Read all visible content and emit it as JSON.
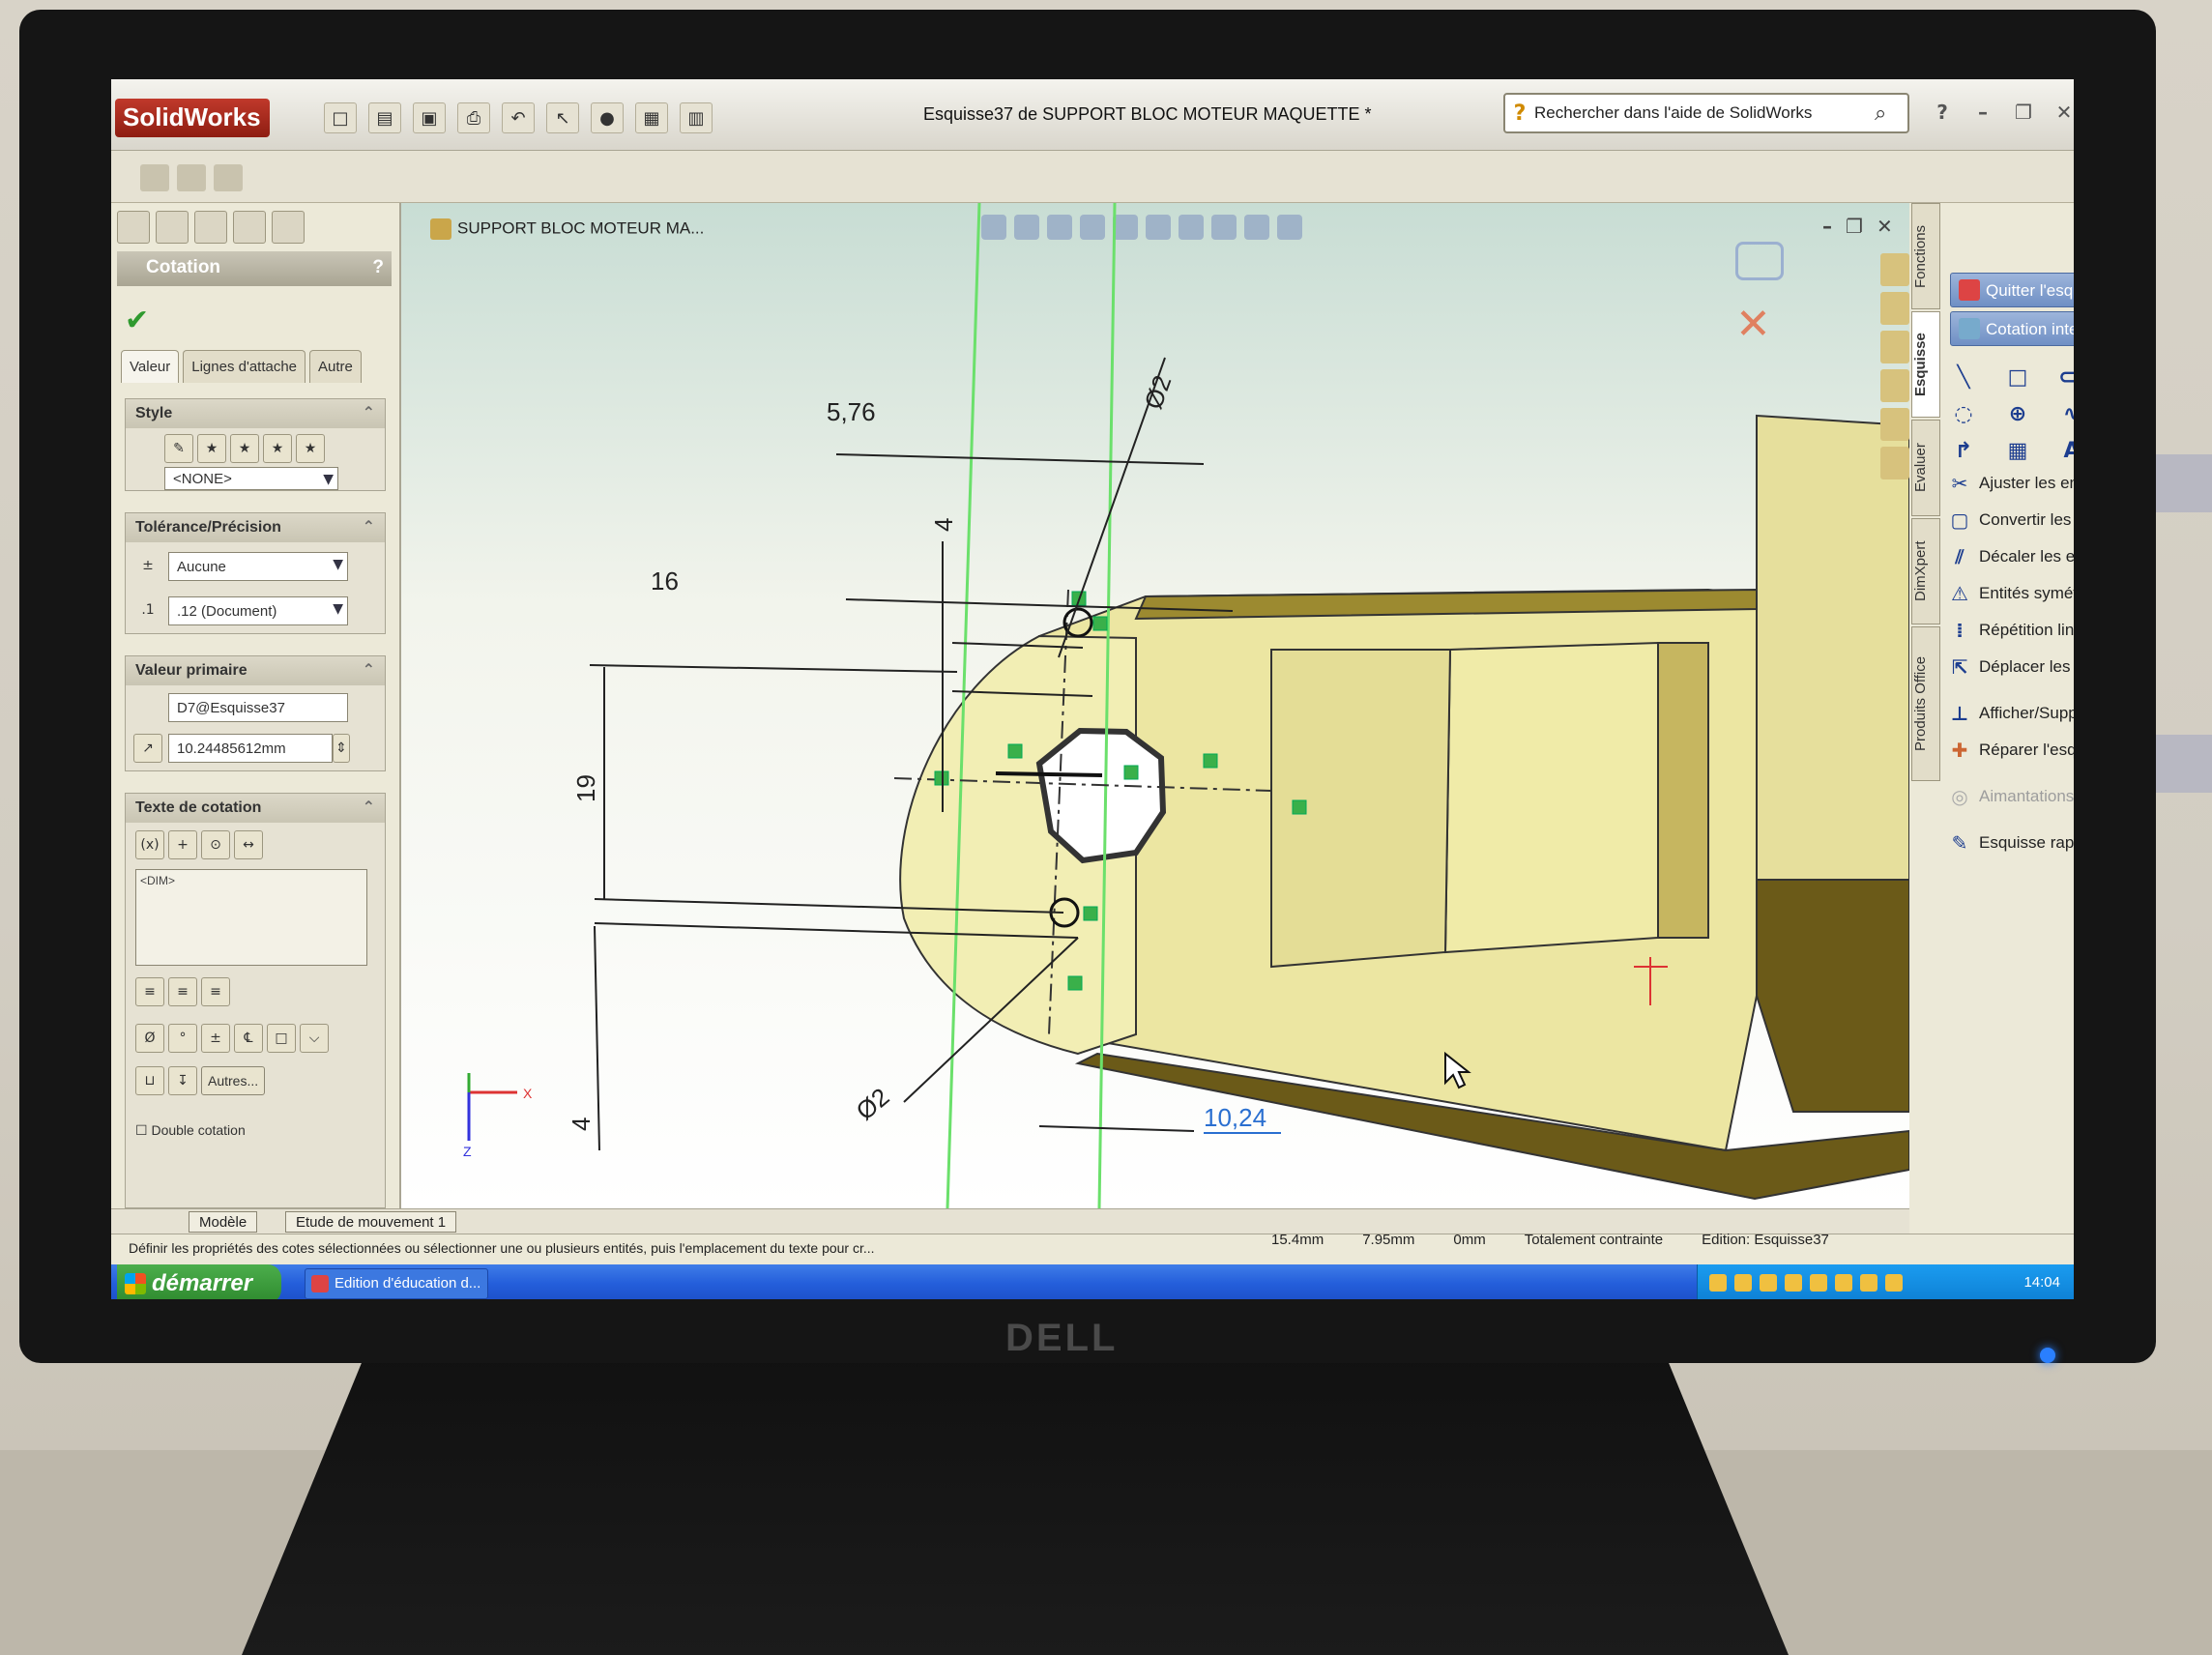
{
  "app": {
    "logo_text": "SolidWorks",
    "document_title": "Esquisse37 de SUPPORT BLOC MOTEUR MAQUETTE *",
    "help_search_text": "Rechercher dans l'aide de SolidWorks",
    "monitor_brand": "DELL"
  },
  "property_manager": {
    "title": "Cotation",
    "help": "?",
    "ok_icon": "check-icon",
    "tabs": [
      "Valeur",
      "Lignes d'attache",
      "Autre"
    ],
    "style": {
      "header": "Style",
      "favorite_value": "<NONE>"
    },
    "tolerance": {
      "header": "Tolérance/Précision",
      "tolerance_type": "Aucune",
      "precision": ".12 (Document)"
    },
    "primary_value": {
      "header": "Valeur primaire",
      "name": "D7@Esquisse37",
      "value": "10.24485612mm"
    },
    "dimension_text": {
      "header": "Texte de cotation",
      "text": "<DIM>",
      "more_button": "Autres...",
      "dual_dimension_label": "Double cotation"
    }
  },
  "graphics": {
    "breadcrumb": "SUPPORT BLOC MOTEUR MA...",
    "dimensions": {
      "d_576": "5,76",
      "d_dia_top": "Ø2",
      "d_4_top": "4",
      "d_16": "16",
      "d_19": "19",
      "d_4_bottom": "4",
      "d_dia_bottom": "Ø2",
      "d_1024": "10,24"
    },
    "triad": {
      "x": "X",
      "z": "Z"
    }
  },
  "command_manager": {
    "exit_sketch": "Quitter l'esquisse",
    "smart_dimension": "Cotation intelligente",
    "commands": [
      {
        "label": "Ajuster les entités",
        "icon": "trim-icon",
        "enabled": true
      },
      {
        "label": "Convertir les entités",
        "icon": "convert-icon",
        "enabled": true
      },
      {
        "label": "Décaler les entités",
        "icon": "offset-icon",
        "enabled": true
      },
      {
        "label": "Entités symétriques",
        "icon": "mirror-icon",
        "enabled": true
      },
      {
        "label": "Répétition linéaire d...",
        "icon": "linear-pattern-icon",
        "enabled": true
      },
      {
        "label": "Déplacer les entités",
        "icon": "move-icon",
        "enabled": true
      },
      {
        "label": "Afficher/Supprimer l...",
        "icon": "display-relations-icon",
        "enabled": true
      },
      {
        "label": "Réparer l'esquisse",
        "icon": "repair-icon",
        "enabled": true
      },
      {
        "label": "Aimantations instan...",
        "icon": "snap-icon",
        "enabled": false
      },
      {
        "label": "Esquisse rapide",
        "icon": "rapid-sketch-icon",
        "enabled": true
      }
    ],
    "tabs": [
      "Fonctions",
      "Esquisse",
      "Evaluer",
      "DimXpert",
      "Produits Office"
    ]
  },
  "bottom_tabs": [
    "Modèle",
    "Etude de mouvement 1"
  ],
  "status": {
    "message": "Définir les propriétés des cotes sélectionnées ou sélectionner une ou plusieurs entités, puis l'emplacement du texte pour cr...",
    "x": "15.4mm",
    "y": "7.95mm",
    "z": "0mm",
    "state": "Totalement contrainte",
    "editing": "Edition: Esquisse37"
  },
  "taskbar": {
    "start": "démarrer",
    "task": "Edition d'éducation d...",
    "clock": "14:04"
  }
}
